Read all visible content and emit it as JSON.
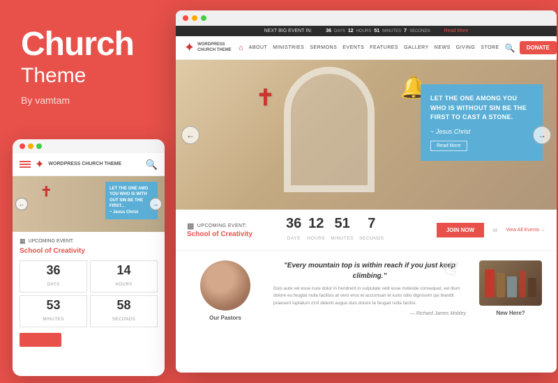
{
  "left": {
    "title": "Church",
    "subtitle": "Theme",
    "by": "By vamtam"
  },
  "mobile": {
    "logo_text": "WORDPRESS\nCHURCH\nTHEME",
    "event_label": "UPCOMING EVENT:",
    "event_title": "School of Creativity",
    "count_days_num": "36",
    "count_days_label": "DAYS",
    "count_hours_num": "14",
    "count_hours_label": "HOURS",
    "count_minutes_num": "53",
    "count_minutes_label": "MINUTES",
    "count_seconds_num": "58",
    "count_seconds_label": "SECONDS",
    "quote": "LET THE ONE AMO YOU WHO IS WITH OUT SIN BE THE FIRST...",
    "quote_author": "~ Jesus Christ"
  },
  "desktop": {
    "top_bar": {
      "next_event_label": "NEXT BIG EVENT IN:",
      "days": "36",
      "days_unit": "DAYS",
      "hours": "12",
      "hours_unit": "HOURS",
      "minutes": "51",
      "minutes_unit": "MINUTES",
      "seconds": "7",
      "seconds_unit": "SECONDS",
      "read_more": "Read More"
    },
    "nav": {
      "logo_text": "WORDPRESS\nCHURCH\nTHEME",
      "links": [
        "ABOUT",
        "MINISTRIES",
        "SERMONS",
        "EVENTS",
        "FEATURES",
        "GALLERY",
        "NEWS",
        "GIVING",
        "STORE"
      ],
      "donate": "Donate"
    },
    "hero": {
      "quote": "LET THE ONE AMONG YOU WHO IS WITHOUT SIN BE THE FIRST TO CAST A STONE.",
      "author": "~ Jesus Christ",
      "btn": "Read More"
    },
    "event": {
      "label": "UPCOMING EVENT:",
      "title": "School of Creativity",
      "days_num": "36",
      "days_label": "DAYS",
      "hours_num": "12",
      "hours_label": "HOURS",
      "minutes_num": "51",
      "minutes_label": "MINUTES",
      "seconds_num": "7",
      "seconds_label": "SECONDS",
      "join": "Join now",
      "or": "or",
      "view_all": "View All Events →"
    },
    "quote_section": {
      "main": "\"Every mountain top is within reach if you just keep climbing.\"",
      "body": "Duis aute vel esse irure dolor in hendrerit in vulputate velit esse molestie consequat, vel illum dolore eu feugiat nulla facilisis at vero eros et accumsan et iusto odio dignissim qui blandit praesent luptatum zzril delenit augue duis dolore te feugait nulla facilisi.",
      "attribution": "— Richard James Mobley"
    },
    "pastor": {
      "label": "Our Pastors"
    },
    "new_here": {
      "label": "New Here?"
    }
  }
}
